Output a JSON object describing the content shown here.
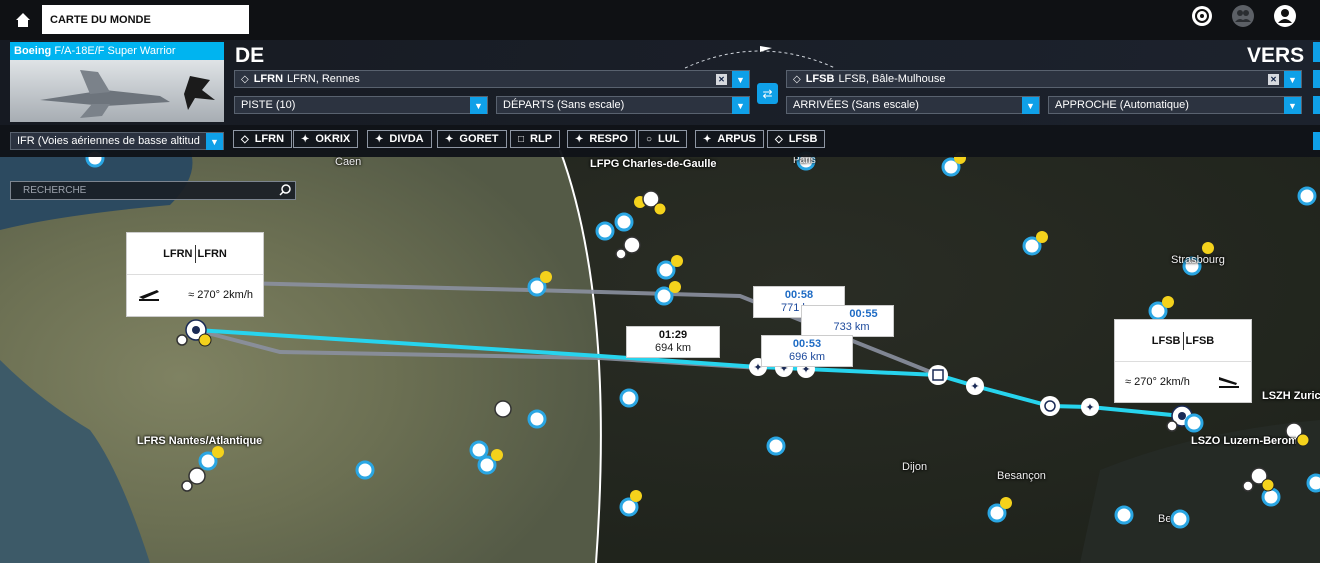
{
  "topbar": {
    "title": "CARTE DU MONDE",
    "icons": [
      "home-icon",
      "target-icon",
      "friends-icon",
      "profile-icon"
    ]
  },
  "aircraft": {
    "brand": "Boeing",
    "model": "F/A-18E/F Super Warrior"
  },
  "departure": {
    "heading": "DE",
    "icao": "LFRN",
    "name": "LFRN, Rennes",
    "runway": "PISTE (10)",
    "procedure": "DÉPARTS (Sans escale)"
  },
  "arrival": {
    "heading": "VERS",
    "icao": "LFSB",
    "name": "LFSB, Bâle-Mulhouse",
    "procedure": "ARRIVÉES (Sans escale)",
    "approach": "APPROCHE (Automatique)"
  },
  "flight_type": "IFR (Voies aériennes de basse altitud",
  "waypoints": [
    "LFRN",
    "OKRIX",
    "DIVDA",
    "GORET",
    "RLP",
    "RESPO",
    "LUL",
    "ARPUS",
    "LFSB"
  ],
  "search": {
    "placeholder": "RECHERCHE"
  },
  "map": {
    "cities": [
      "Caen",
      "LFPG Charles-de-Gaulle",
      "Paris",
      "Strasbourg",
      "LFRS Nantes/Atlantique",
      "Dijon",
      "Besançon",
      "LSZH Zurich",
      "LSZO Luzern-Beromünster",
      "Bern"
    ],
    "legs": [
      {
        "time": "00:58",
        "dist": "771 km"
      },
      {
        "time": "00:55",
        "dist": "733 km"
      },
      {
        "time": "01:29",
        "dist": "694 km"
      },
      {
        "time": "00:53",
        "dist": "696 km"
      }
    ],
    "origin_popup": {
      "code_a": "LFRN",
      "code_b": "LFRN",
      "wind": "270° 2km/h"
    },
    "dest_popup": {
      "code_a": "LFSB",
      "code_b": "LFSB",
      "wind": "270° 2km/h"
    }
  },
  "colors": {
    "accent": "#0fa0e8",
    "route": "#27d4ee",
    "warning": "#f4d21c"
  }
}
